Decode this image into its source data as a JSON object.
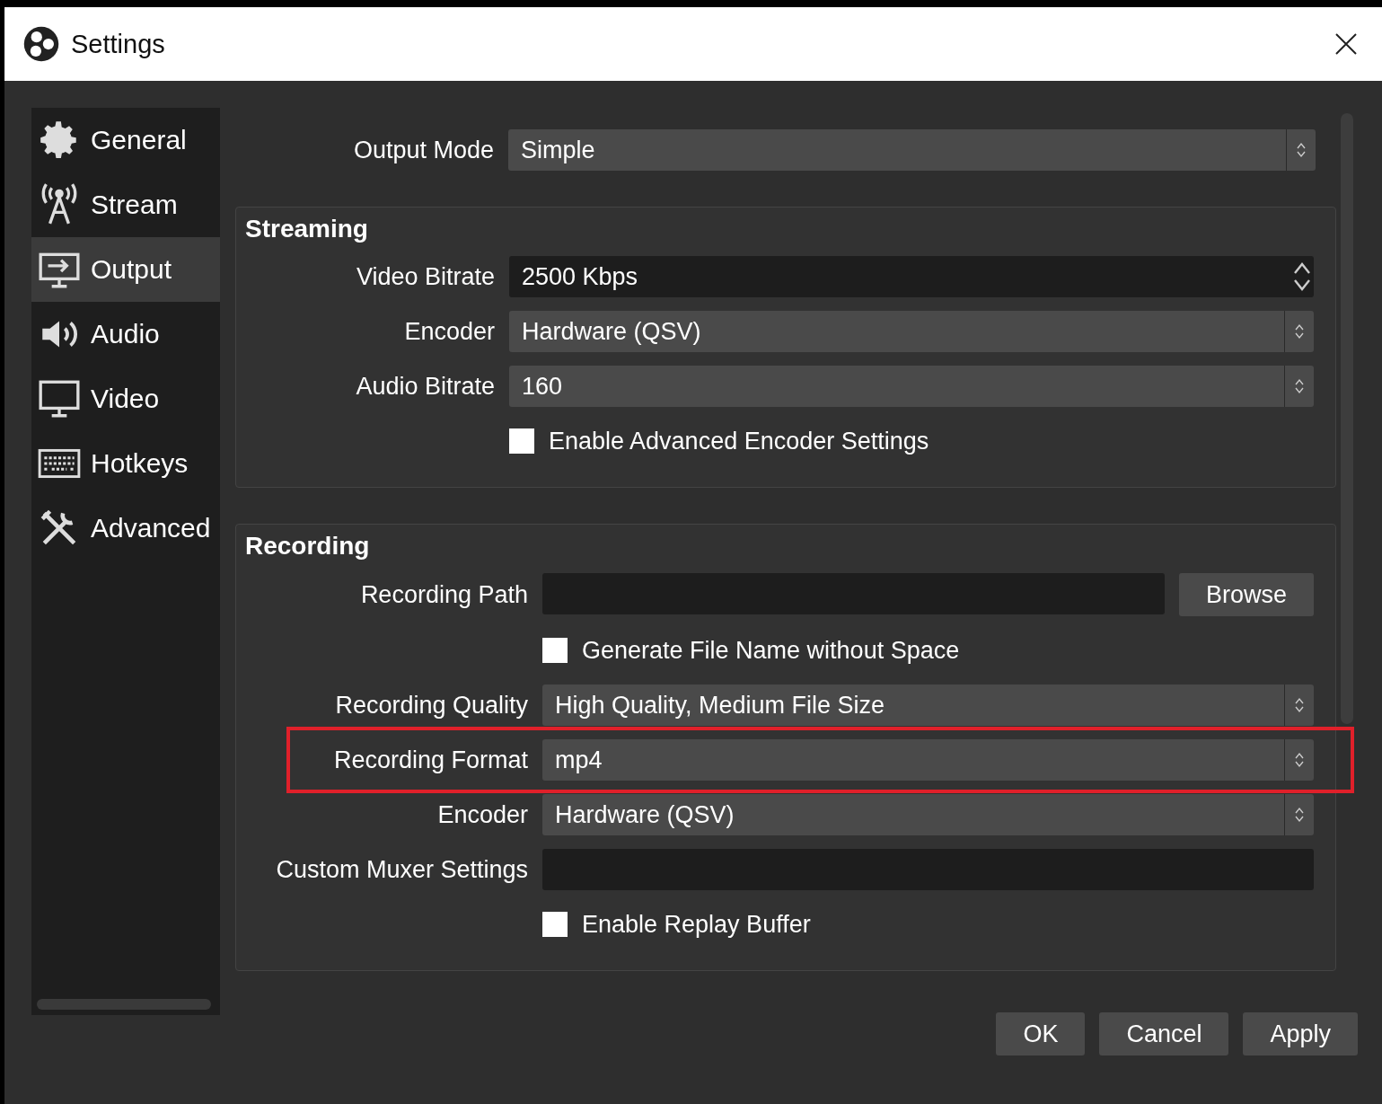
{
  "window": {
    "title": "Settings"
  },
  "sidebar": {
    "items": [
      {
        "label": "General",
        "selected": false
      },
      {
        "label": "Stream",
        "selected": false
      },
      {
        "label": "Output",
        "selected": true
      },
      {
        "label": "Audio",
        "selected": false
      },
      {
        "label": "Video",
        "selected": false
      },
      {
        "label": "Hotkeys",
        "selected": false
      },
      {
        "label": "Advanced",
        "selected": false
      }
    ]
  },
  "output_mode": {
    "label": "Output Mode",
    "value": "Simple"
  },
  "groups": [
    {
      "title": "Streaming",
      "rows": [
        {
          "kind": "spinbox",
          "label": "Video Bitrate",
          "value": "2500 Kbps"
        },
        {
          "kind": "select",
          "label": "Encoder",
          "value": "Hardware (QSV)"
        },
        {
          "kind": "select",
          "label": "Audio Bitrate",
          "value": "160"
        },
        {
          "kind": "checkbox",
          "label": "Enable Advanced Encoder Settings",
          "checked": false
        }
      ]
    },
    {
      "title": "Recording",
      "rows": [
        {
          "kind": "path",
          "label": "Recording Path",
          "button": "Browse"
        },
        {
          "kind": "checkbox",
          "label": "Generate File Name without Space",
          "checked": false
        },
        {
          "kind": "select",
          "label": "Recording Quality",
          "value": "High Quality, Medium File Size"
        },
        {
          "kind": "select",
          "label": "Recording Format",
          "value": "mp4",
          "highlighted": true
        },
        {
          "kind": "select",
          "label": "Encoder",
          "value": "Hardware (QSV)"
        },
        {
          "kind": "text",
          "label": "Custom Muxer Settings"
        },
        {
          "kind": "checkbox",
          "label": "Enable Replay Buffer",
          "checked": false
        }
      ]
    }
  ],
  "buttons": [
    "OK",
    "Cancel",
    "Apply"
  ]
}
